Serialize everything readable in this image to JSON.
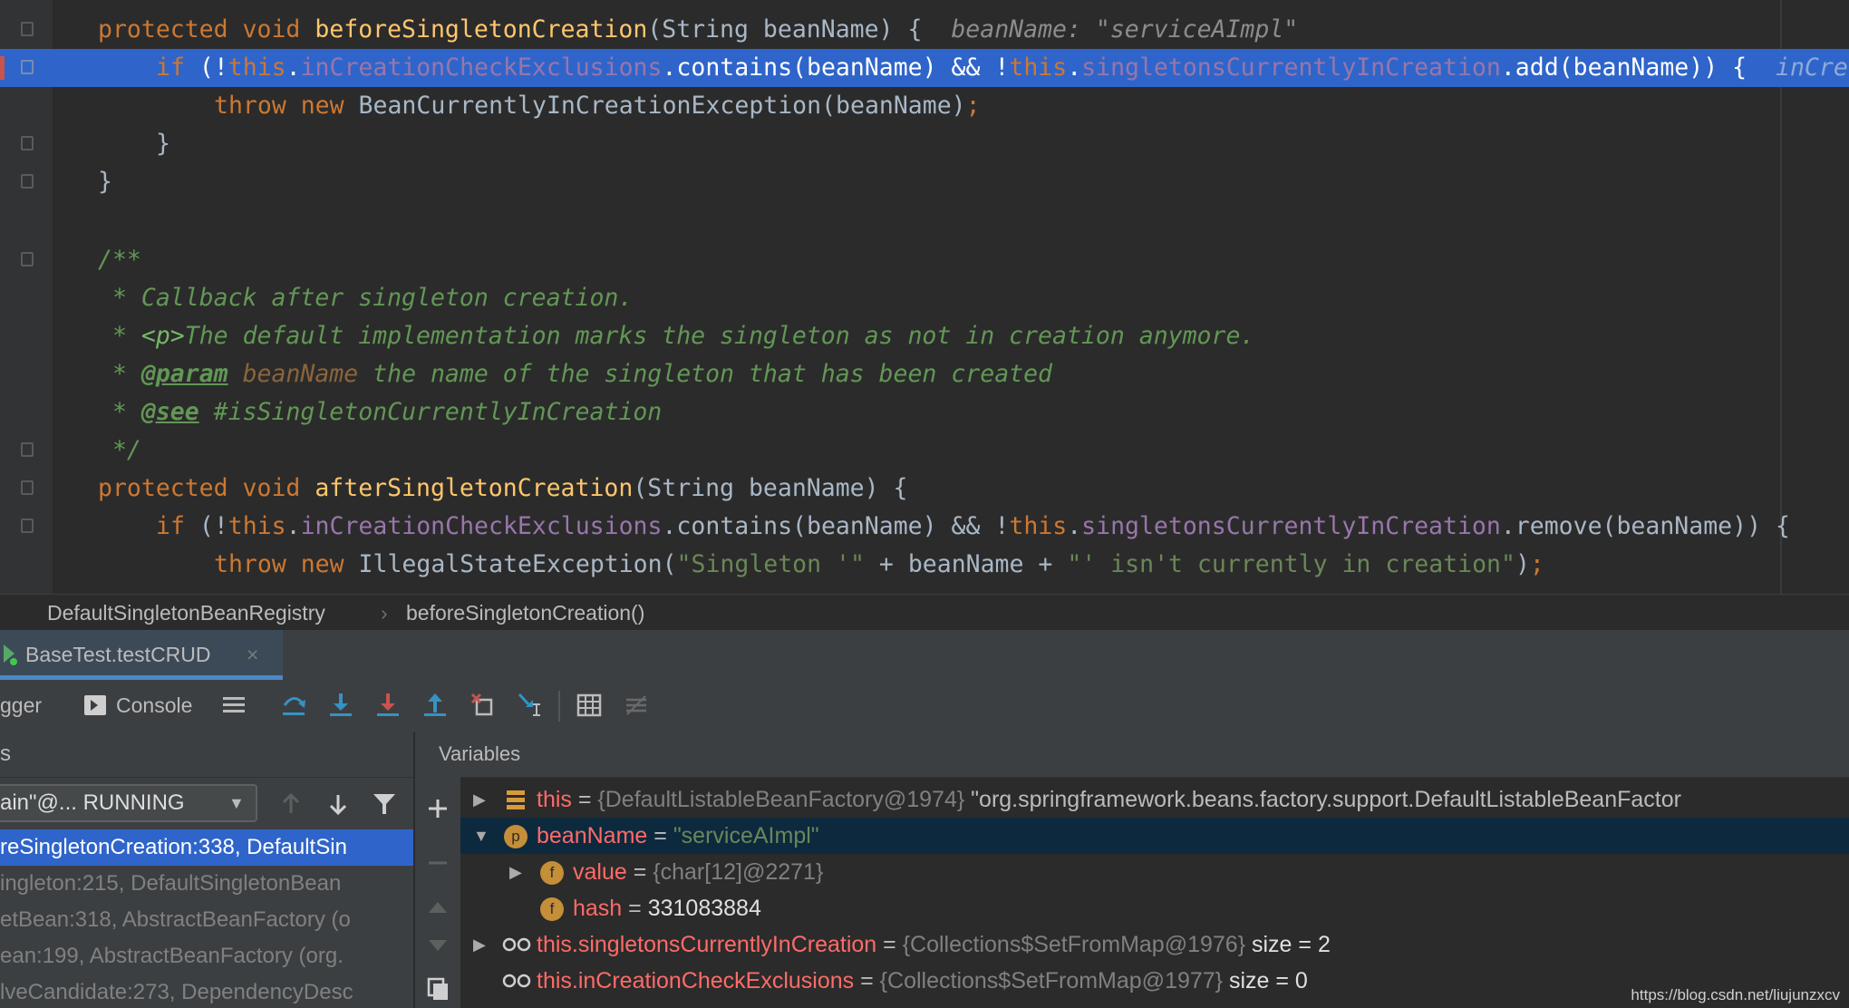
{
  "editor": {
    "lines": {
      "l1_kw": "protected void ",
      "l1_fn": "beforeSingletonCreation",
      "l1_rest": "(String beanName) {",
      "l1_inlay": "beanName: \"serviceAImpl\"",
      "l2_if": "if",
      "l2_a": " (!",
      "l2_this1": "this",
      "l2_dot1": ".",
      "l2_f1": "inCreationCheckExclusions",
      "l2_b": ".contains(beanName) && !",
      "l2_this2": "this",
      "l2_dot2": ".",
      "l2_f2": "singletonsCurrentlyInCreation",
      "l2_c": ".add(beanName)) {",
      "l2_inlay": "inCre",
      "l3_kw": "throw new ",
      "l3_rest": "BeanCurrentlyInCreationException(beanName)",
      "l3_semi": ";",
      "l4": "}",
      "l5": "}",
      "c1": "/**",
      "c2": " * Callback after singleton creation.",
      "c3_a": " * ",
      "c3_p": "<p>",
      "c3_b": "The default implementation marks the singleton as not in creation anymore.",
      "c4_a": " * ",
      "c4_tag": "@param",
      "c4_name": " beanName",
      "c4_b": " the name of the singleton that has been created",
      "c5_a": " * ",
      "c5_tag": "@see",
      "c5_b": " #isSingletonCurrentlyInCreation",
      "c6": " */",
      "l6_kw": "protected void ",
      "l6_fn": "afterSingletonCreation",
      "l6_rest": "(String beanName) {",
      "l7_if": "if",
      "l7_a": " (!",
      "l7_this1": "this",
      "l7_dot1": ".",
      "l7_f1": "inCreationCheckExclusions",
      "l7_b": ".contains(beanName) && !",
      "l7_this2": "this",
      "l7_dot2": ".",
      "l7_f2": "singletonsCurrentlyInCreation",
      "l7_c": ".remove(beanName)) {",
      "l8_kw": "throw new ",
      "l8_a": "IllegalStateException(",
      "l8_s1": "\"Singleton '\"",
      "l8_b": " + beanName + ",
      "l8_s2": "\"' isn't currently in creation\"",
      "l8_c": ")",
      "l8_semi": ";"
    }
  },
  "breadcrumb": {
    "class": "DefaultSingletonBeanRegistry",
    "separator": "›",
    "method": "beforeSingletonCreation()"
  },
  "debug": {
    "run_tab": "BaseTest.testCRUD",
    "run_tab_close": "×",
    "tab_debugger": "gger",
    "tab_console": "Console",
    "frames_header": "s",
    "variables_header": "Variables",
    "thread_select": "ain\"@... RUNNING",
    "frames": [
      "reSingletonCreation:338, DefaultSin",
      "ingleton:215, DefaultSingletonBean",
      "etBean:318, AbstractBeanFactory (o",
      "ean:199, AbstractBeanFactory (org.",
      "lveCandidate:273, DependencyDesc"
    ]
  },
  "variables": [
    {
      "name": "this",
      "eq": " = ",
      "type": "{DefaultListableBeanFactory@1974}",
      "value": " \"org.springframework.beans.factory.support.DefaultListableBeanFactor"
    },
    {
      "name": "beanName",
      "eq": " = ",
      "value": "\"serviceAImpl\"",
      "badge": "p"
    },
    {
      "name": "value",
      "eq": " = ",
      "type": "{char[12]@2271}",
      "badge": "f"
    },
    {
      "name": "hash",
      "eq": " = ",
      "value": "331083884",
      "badge": "f"
    },
    {
      "name": "this.singletonsCurrentlyInCreation",
      "eq": " = ",
      "type": "{Collections$SetFromMap@1976}",
      "value": "  size = 2"
    },
    {
      "name": "this.inCreationCheckExclusions",
      "eq": " = ",
      "type": "{Collections$SetFromMap@1977}",
      "value": "  size = 0"
    }
  ],
  "watermark": "https://blog.csdn.net/liujunzxcv",
  "colors": {
    "editor_bg": "#2b2b2b",
    "selection": "#2f65ca",
    "keyword": "#cc7832",
    "method": "#ffc66d",
    "field": "#9876aa",
    "string": "#6a8759",
    "doc_comment": "#629755"
  }
}
